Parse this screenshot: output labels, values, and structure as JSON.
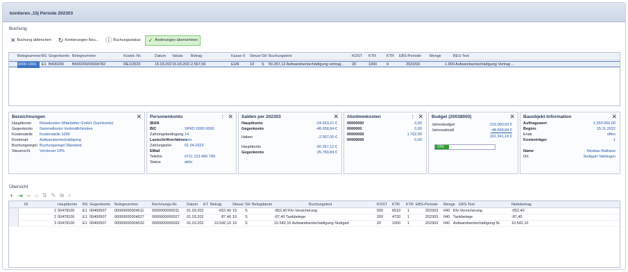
{
  "window": {
    "title": "kontieren ,15| Periode 202303"
  },
  "toolbar_section": {
    "label": "Buchung"
  },
  "toolbar": [
    {
      "icon": "close-x-icon",
      "glyph": "✕",
      "label": "Buchung abbrechen"
    },
    {
      "icon": "refresh-icon",
      "glyph": "↻",
      "label": "Kontierungen Neu..."
    },
    {
      "icon": "info-icon",
      "glyph": "ⓘ",
      "label": "Buchungsstatus"
    },
    {
      "icon": "check-icon",
      "glyph": "✓",
      "label": "Änderungen übernehmen"
    }
  ],
  "top_grid": {
    "columns": [
      "Belegnummer",
      "BS",
      "Gegenkonto",
      "Belegnummer",
      "Kostst.-Nr.",
      "Datum",
      "Valuta",
      "Betrag",
      "Kasse-ID",
      "Steuer",
      "SH",
      "Buchungstext",
      "KOST",
      "KTR",
      "KTR",
      "EBS-Periode",
      "Menge",
      "BES-Text"
    ],
    "row": [
      "0000-1000",
      "E1",
      "B400200",
      "B400200/00004782",
      "RE1/2023",
      "15.03.2023",
      "15.03.2023",
      "2.567,00",
      "EUR",
      "19",
      "S",
      "50.357,12 Aufwandsentschädigung vertrag...",
      "20",
      "1000",
      "0",
      "2023/03",
      "",
      "1.000 Aufwandsentschädigung Vertrag ..."
    ]
  },
  "splitter": "· · · ·",
  "panels": {
    "bezeichnungen": {
      "title": "Bezeichnungen",
      "rows": [
        {
          "k": "Hauptkonto",
          "v": "Reisekosten Mitarbeiter GmbH (Sachkonto)"
        },
        {
          "k": "Gegenkonto",
          "v": "Sammelkonto Verbindlichkeiten"
        },
        {
          "k": "Kostenstelle",
          "v": "Kostenstelle 1000"
        },
        {
          "k": "Kostenart",
          "v": "Aufwandsentschädigung"
        },
        {
          "k": "Buchungsregel",
          "v": "Buchungsregel Standard"
        },
        {
          "k": "Steuerschl.",
          "v": "Vorsteuer 19%"
        }
      ]
    },
    "personenkonto": {
      "title": "Personenkonto",
      "rows": [
        {
          "k": "IBAN",
          "v": ""
        },
        {
          "k": "BIC",
          "v": "SPKD 0000 0000"
        },
        {
          "k": "Zahlungsbedingung",
          "v": "14"
        },
        {
          "k": "Lastschriftverfahren",
          "v": "nein"
        },
        {
          "k": "Zahlungsziel",
          "v": "01.04.2023"
        },
        {
          "k": "EMail",
          "v": ""
        },
        {
          "k": "Telefon",
          "v": "0711 123 456 789"
        },
        {
          "k": "Status",
          "v": "aktiv"
        }
      ]
    },
    "salden": {
      "title": "Salden per 202303",
      "rows": [
        {
          "k": "Hauptkonto",
          "v": "-24.563,21 €"
        },
        {
          "k": "Gegenkonto",
          "v": "-48.658,84 €"
        },
        {
          "k": "Haben",
          "v": "-2.567,00 €"
        },
        {
          "k": "Hauptkonto",
          "v": "-50.357,12 €"
        },
        {
          "k": "Gegenkonto",
          "v": "25.789,84 €"
        }
      ]
    },
    "abstimmkosten": {
      "title": "Abstimmkosten",
      "rows": [
        {
          "k": "00000000",
          "v": "0,00"
        },
        {
          "k": "0000000",
          "v": "0,00"
        },
        {
          "k": "00000000",
          "v": "1.762,00"
        },
        {
          "k": "00000000",
          "v": "0,00"
        }
      ]
    },
    "budget": {
      "title": "Budget (20038000)",
      "rows": [
        {
          "k": "Jahresbudget",
          "v": "210.000,00 €"
        },
        {
          "k": "Jahresaktuell",
          "v": "-48.658,84 €"
        },
        {
          "k": "",
          "v": "161.341,16 €"
        }
      ],
      "progress_label": "23%",
      "progress_value": 0.23
    },
    "bauobjekt": {
      "title": "Bauobjekt-Information",
      "rows": [
        {
          "k": "Auftragswert",
          "v": "1.250.000,00"
        },
        {
          "k": "Beginn",
          "v": "15.11.2022"
        },
        {
          "k": "Ende",
          "v": "offen"
        },
        {
          "k": "Kostenträger",
          "v": "1"
        },
        {
          "k": "Name",
          "v": "Neubau Rathaus"
        },
        {
          "k": "Ort",
          "v": "Stuttgart Vaihingen"
        }
      ]
    }
  },
  "overview": {
    "label": "Übersicht",
    "columns": [
      "ID",
      "Hauptkonto",
      "BS",
      "Gegenkonto",
      "Belegnummer",
      "Rechnungs-Nr.",
      "Datum",
      "ET",
      "Betrag",
      "Steuer",
      "SH",
      "Belegdatum",
      "Buchungstext",
      "KOST",
      "KTR",
      "KTR",
      "EBS-Periode",
      "Menge",
      "EBS-Text",
      "Nettobetrag"
    ],
    "rows": [
      [
        "1",
        "00478100",
        "E1",
        "00400507",
        "00000000004511",
        "0000000000011",
        "01.03.2023",
        "",
        "-652,40",
        "19",
        "S",
        "",
        "-652,40 Kfz-Versicherung",
        "500",
        "6510",
        "1",
        "202303",
        "040",
        "Kfz-Versicherung",
        "-652,40"
      ],
      [
        "2",
        "00478100",
        "E1",
        "00400507",
        "00000000004527",
        "0000000000027",
        "01.03.2023",
        "",
        "-87,40",
        "19",
        "S",
        "",
        "-87,40 Tankbelege",
        "200",
        "4720",
        "1",
        "202303",
        "040",
        "Tankbelege",
        "-87,40"
      ],
      [
        "3",
        "00478100",
        "E1",
        "00400507",
        "00000000004532",
        "0000000000032",
        "01.03.2023",
        "",
        "10.542,10",
        "19",
        "S",
        "",
        "10.542,10 Aufwandsentschädigung Stuttgart",
        "20",
        "1000",
        "1",
        "202303",
        "040",
        "Aufwandsentschädigung St.",
        "10.542,10"
      ]
    ]
  }
}
